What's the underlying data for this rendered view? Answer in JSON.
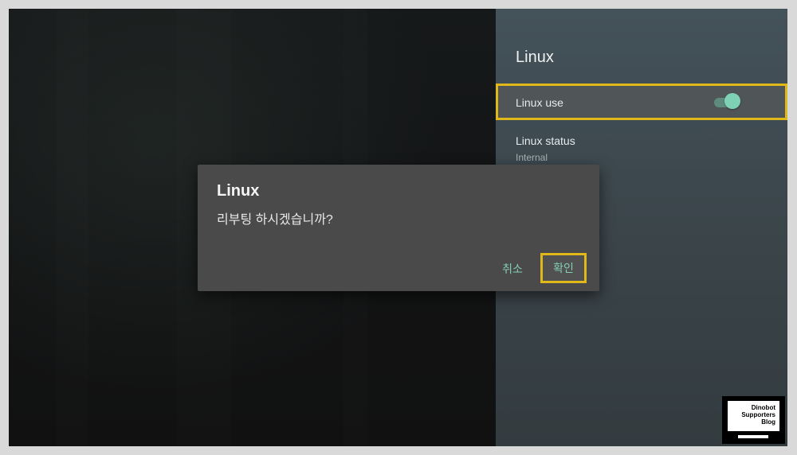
{
  "panel": {
    "title": "Linux",
    "items": [
      {
        "label": "Linux use",
        "toggle_on": true
      },
      {
        "label": "Linux status",
        "value": "Internal"
      }
    ]
  },
  "dialog": {
    "title": "Linux",
    "message": "리부팅 하시겠습니까?",
    "cancel_label": "취소",
    "confirm_label": "확인"
  },
  "watermark": {
    "lines": [
      "Dinobot",
      "Supporters",
      "Blog"
    ]
  },
  "colors": {
    "accent": "#80cbc4",
    "focus_outline": "#e0b81a",
    "panel_bg": "#3f4a4f",
    "dialog_bg": "#4a4a4b"
  }
}
